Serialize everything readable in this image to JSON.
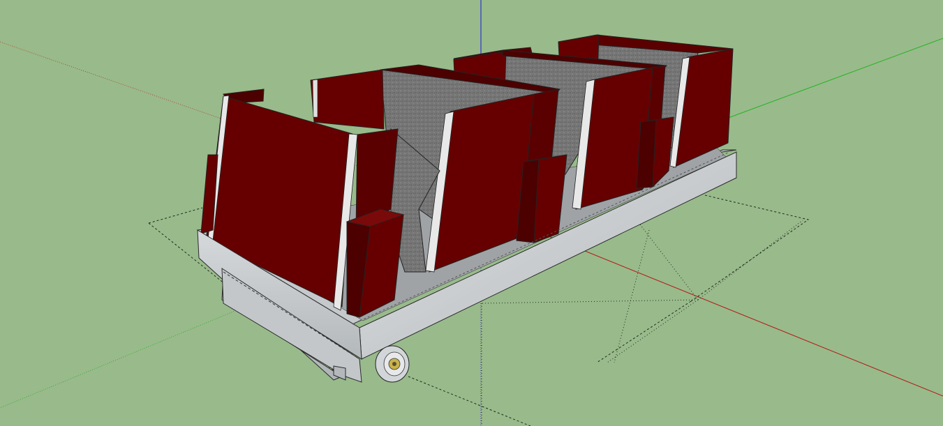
{
  "viewport": {
    "background_color": "#99bb8b"
  },
  "axes": {
    "red_color": "#b31a1a",
    "green_color": "#1fb31f",
    "blue_color": "#1a1ad9"
  },
  "model": {
    "seat_red": "#660000",
    "seat_red_dark": "#4d0000",
    "seat_red_side": "#7a0a0a",
    "carpet_gray": "#6e6e6e",
    "floor_dark": "#3a3a3a",
    "frame_metal": "#cfd2d4",
    "frame_metal_shade": "#aeb2b5",
    "trim_white": "#e8e8e8"
  }
}
